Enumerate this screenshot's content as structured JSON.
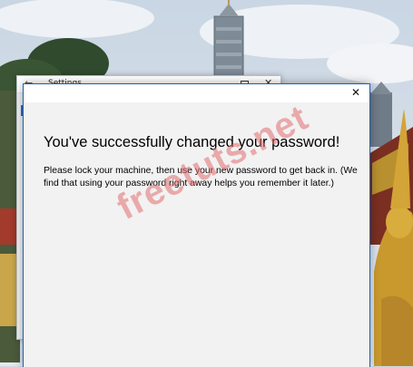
{
  "settings_window": {
    "title": "Settings",
    "back_glyph": "←",
    "close_glyph": "✕"
  },
  "dialog": {
    "close_glyph": "✕",
    "heading": "You've successfully changed your password!",
    "message": "Please lock your machine, then use your new password to get back in. (We find that using your password right away helps you remember it later.)"
  },
  "watermark": {
    "text": "freetuts.net"
  },
  "colors": {
    "accent_border": "#1f5fb8",
    "dialog_background": "#f2f2f2",
    "watermark": "#e26e70"
  }
}
